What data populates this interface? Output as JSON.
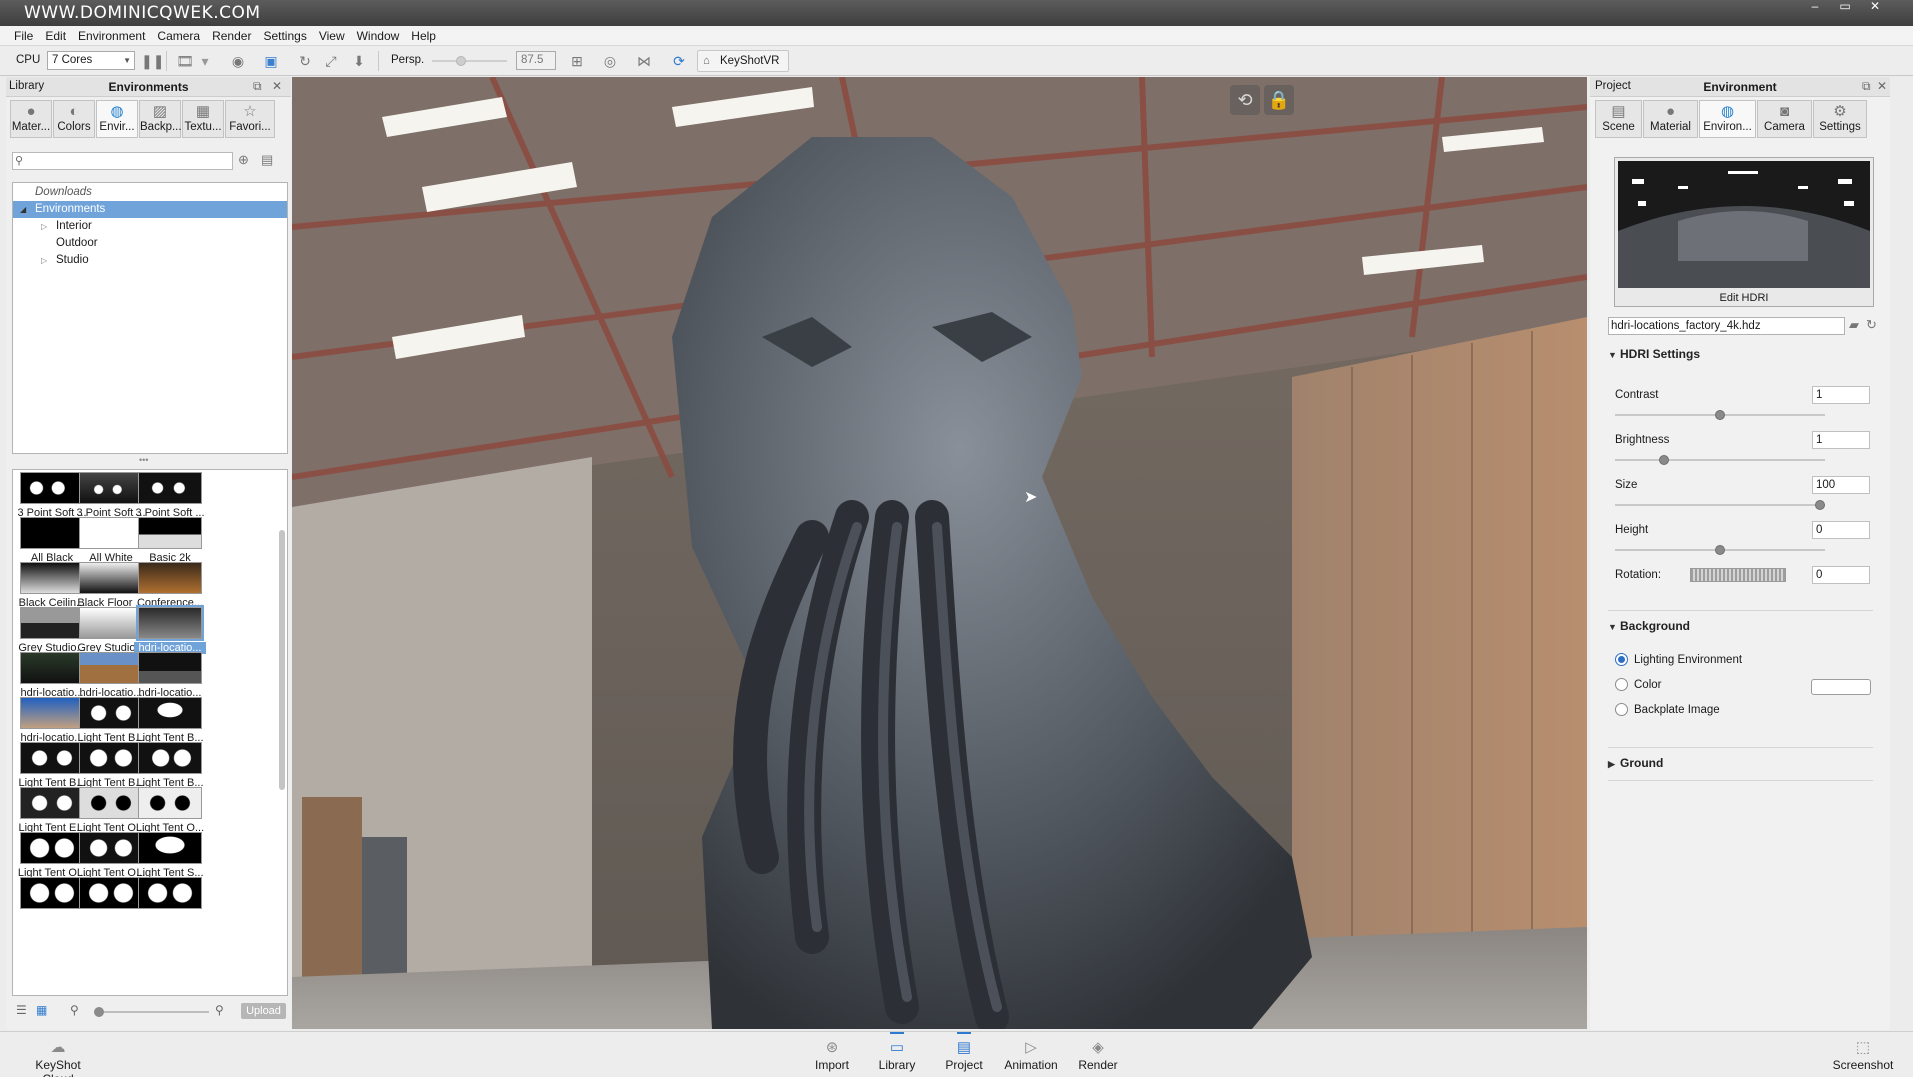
{
  "window": {
    "title": "WWW.DOMINICQWEK.COM",
    "controls": [
      "–",
      "▭",
      "✕"
    ]
  },
  "menu": [
    "File",
    "Edit",
    "Environment",
    "Camera",
    "Render",
    "Settings",
    "View",
    "Window",
    "Help"
  ],
  "toolbar": {
    "cpu_label": "CPU",
    "cores_value": "7 Cores",
    "projection_label": "Persp.",
    "fov_value": "87.5",
    "keyshotvr_label": "KeyShotVR"
  },
  "library": {
    "title": "Library",
    "panel_title": "Environments",
    "tabs": [
      "Mater...",
      "Colors",
      "Envir...",
      "Backp...",
      "Textu...",
      "Favori..."
    ],
    "tree": {
      "downloads": "Downloads",
      "environments": "Environments",
      "interior": "Interior",
      "outdoor": "Outdoor",
      "studio": "Studio"
    },
    "thumbnails": [
      "3 Point Soft ...",
      "3 Point Soft ...",
      "3 Point Soft ...",
      "All Black",
      "All White",
      "Basic 2k",
      "Black Ceilin...",
      "Black Floor ...",
      "Conference...",
      "Grey Studio...",
      "Grey Studio...",
      "hdri-locatio...",
      "hdri-locatio...",
      "hdri-locatio...",
      "hdri-locatio...",
      "hdri-locatio...",
      "Light Tent B...",
      "Light Tent B...",
      "Light Tent B...",
      "Light Tent B...",
      "Light Tent B...",
      "Light Tent E...",
      "Light Tent O...",
      "Light Tent O...",
      "Light Tent O...",
      "Light Tent O...",
      "Light Tent S..."
    ],
    "upload_label": "Upload"
  },
  "project": {
    "title": "Project",
    "panel_title": "Environment",
    "tabs": [
      "Scene",
      "Material",
      "Environ...",
      "Camera",
      "Settings"
    ],
    "edit_hdri": "Edit HDRI",
    "hdri_file": "hdri-locations_factory_4k.hdz",
    "hdri_settings_label": "HDRI Settings",
    "contrast": {
      "label": "Contrast",
      "value": "1",
      "level": 0.5
    },
    "brightness": {
      "label": "Brightness",
      "value": "1",
      "level": 0.22
    },
    "size": {
      "label": "Size",
      "value": "100",
      "level": 1.0
    },
    "height": {
      "label": "Height",
      "value": "0",
      "level": 0.5
    },
    "rotation": {
      "label": "Rotation:",
      "value": "0"
    },
    "background_label": "Background",
    "bg_options": [
      "Lighting Environment",
      "Color",
      "Backplate Image"
    ],
    "bg_selected": "Lighting Environment",
    "ground_label": "Ground"
  },
  "bottom": {
    "cloud": "KeyShot Cloud",
    "buttons": [
      "Import",
      "Library",
      "Project",
      "Animation",
      "Render"
    ],
    "screenshot": "Screenshot"
  },
  "colors": {
    "accent": "#2e7ad0",
    "selection": "#6fa3da"
  }
}
